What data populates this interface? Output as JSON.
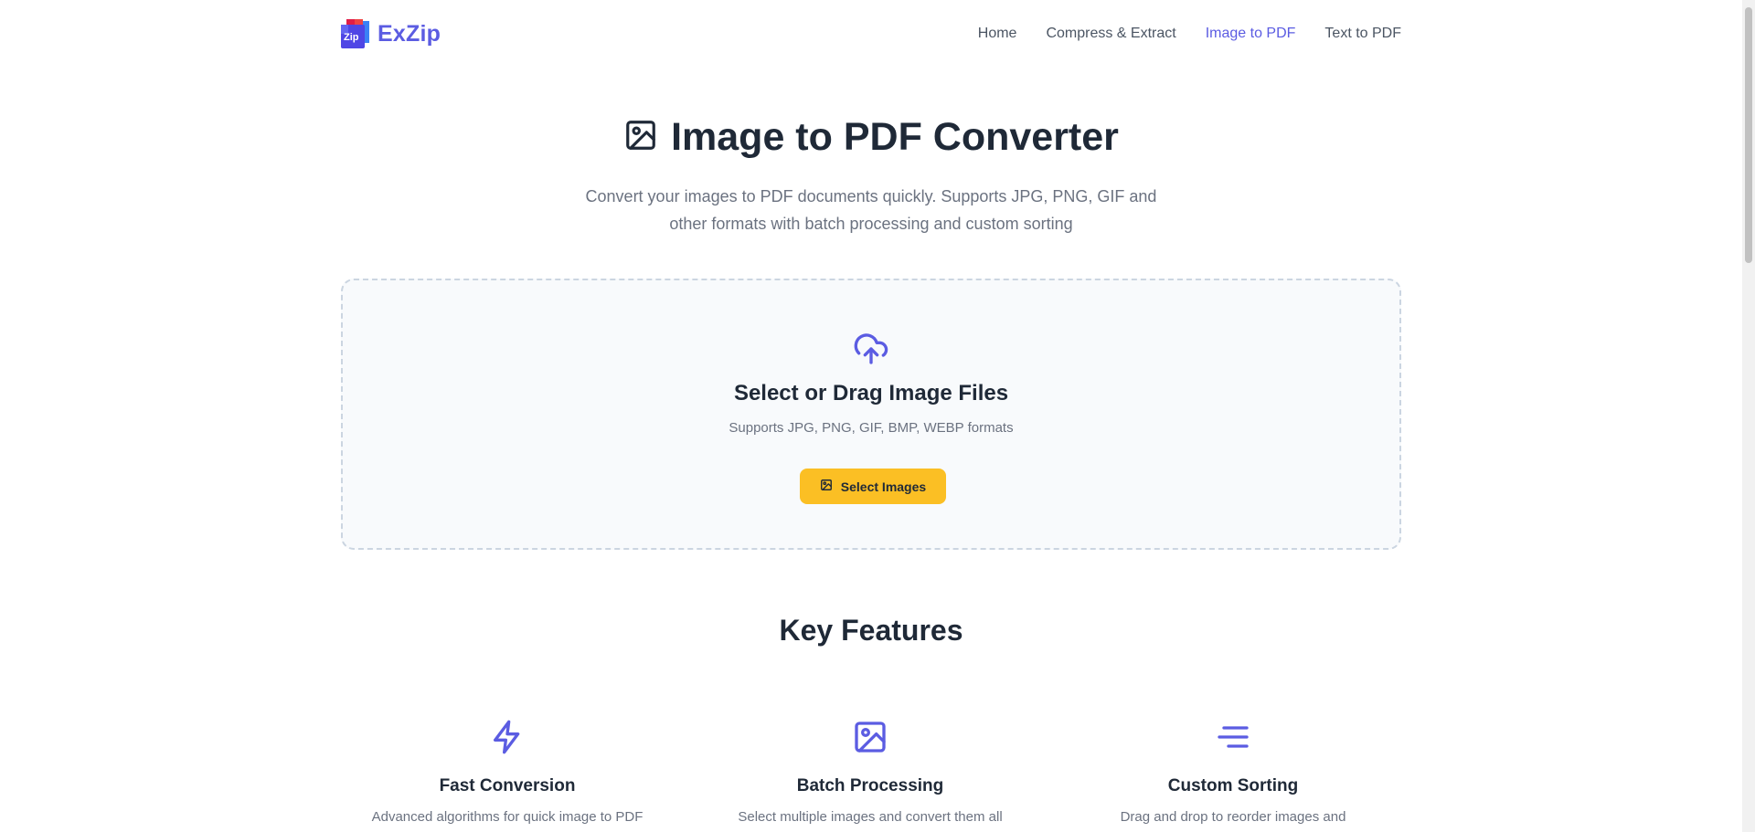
{
  "header": {
    "brand": "ExZip",
    "logo_text": "Zip",
    "nav": [
      {
        "label": "Home",
        "active": false
      },
      {
        "label": "Compress & Extract",
        "active": false
      },
      {
        "label": "Image to PDF",
        "active": true
      },
      {
        "label": "Text to PDF",
        "active": false
      }
    ]
  },
  "hero": {
    "title": "Image to PDF Converter",
    "subtitle_line1": "Convert your images to PDF documents quickly. Supports JPG, PNG, GIF and",
    "subtitle_line2": "other formats with batch processing and custom sorting",
    "icon": "image-icon"
  },
  "dropzone": {
    "icon": "cloud-upload-icon",
    "title": "Select or Drag Image Files",
    "subtitle": "Supports JPG, PNG, GIF, BMP, WEBP formats",
    "button_label": "Select Images",
    "button_icon": "image-icon"
  },
  "features": {
    "title": "Key Features",
    "items": [
      {
        "icon": "lightning-icon",
        "title": "Fast Conversion",
        "desc": "Advanced algorithms for quick image to PDF"
      },
      {
        "icon": "image-icon",
        "title": "Batch Processing",
        "desc": "Select multiple images and convert them all"
      },
      {
        "icon": "sort-icon",
        "title": "Custom Sorting",
        "desc": "Drag and drop to reorder images and"
      }
    ]
  },
  "colors": {
    "accent": "#5b5ce2",
    "button": "#fbbf24",
    "text": "#1f2937",
    "muted": "#6b7280"
  }
}
